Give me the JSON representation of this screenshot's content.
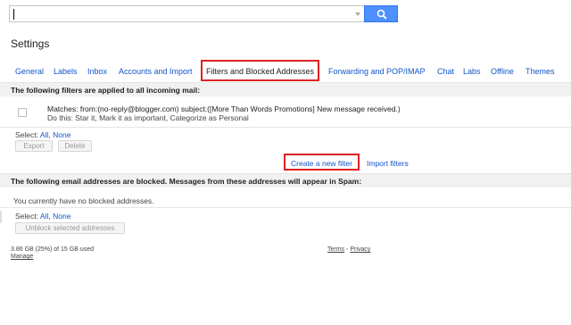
{
  "search": {
    "value": ""
  },
  "page_title": "Settings",
  "tabs": [
    {
      "label": "General"
    },
    {
      "label": "Labels"
    },
    {
      "label": "Inbox"
    },
    {
      "label": "Accounts and Import"
    },
    {
      "label": "Filters and Blocked Addresses"
    },
    {
      "label": "Forwarding and POP/IMAP"
    },
    {
      "label": "Chat"
    },
    {
      "label": "Labs"
    },
    {
      "label": "Offline"
    },
    {
      "label": "Themes"
    }
  ],
  "filters_section": {
    "heading": "The following filters are applied to all incoming mail:",
    "filter": {
      "matches": "Matches: from:(no-reply@blogger.com) subject:([More Than Words Promotions] New message received.)",
      "action": "Do this: Star it, Mark it as important, Categorize as Personal"
    },
    "select_label": "Select:",
    "select_all": "All",
    "select_sep": ",",
    "select_none": "None",
    "export_label": "Export",
    "delete_label": "Delete",
    "create_filter": "Create a new filter",
    "import_filters": "Import filters"
  },
  "blocked_section": {
    "heading": "The following email addresses are blocked. Messages from these addresses will appear in Spam:",
    "empty_text": "You currently have no blocked addresses.",
    "select_label": "Select:",
    "select_all": "All",
    "select_sep": ",",
    "select_none": "None",
    "unblock_label": "Unblock selected addresses"
  },
  "footer": {
    "storage": "3.86 GB (25%) of 15 GB used",
    "manage": "Manage",
    "terms": "Terms",
    "sep": "-",
    "privacy": "Privacy"
  }
}
